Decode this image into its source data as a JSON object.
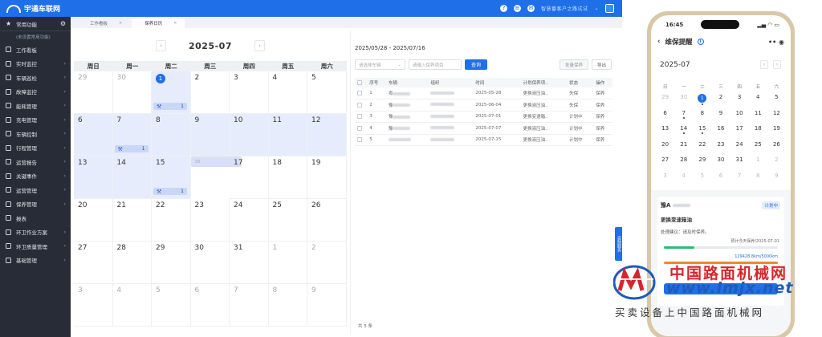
{
  "app": {
    "logo_text": "宇通车联网",
    "user_masked": "智慧番客户之路试试"
  },
  "sidebar": {
    "favorites_label": "常用功能",
    "favorites_empty": "(未设置常用功能)",
    "items": [
      {
        "label": "工作看板",
        "arrow": false
      },
      {
        "label": "实时监控",
        "arrow": true
      },
      {
        "label": "车辆巡检",
        "arrow": true
      },
      {
        "label": "故障监控",
        "arrow": true
      },
      {
        "label": "能耗管理",
        "arrow": true
      },
      {
        "label": "充电管理",
        "arrow": true
      },
      {
        "label": "车辆控制",
        "arrow": true
      },
      {
        "label": "行程管理",
        "arrow": true
      },
      {
        "label": "运营报告",
        "arrow": true
      },
      {
        "label": "关键事件",
        "arrow": true
      },
      {
        "label": "运营管理",
        "arrow": true
      },
      {
        "label": "保养管理",
        "arrow": true
      },
      {
        "label": "报表",
        "arrow": false
      },
      {
        "label": "环卫作业方案",
        "arrow": true
      },
      {
        "label": "环卫质量管理",
        "arrow": true
      },
      {
        "label": "基础管理",
        "arrow": true
      }
    ]
  },
  "tabs": [
    {
      "label": "工作看板"
    },
    {
      "label": "保养日历"
    }
  ],
  "calendar": {
    "month": "2025-07",
    "prev": "‹",
    "next": "›",
    "weekdays": [
      "周日",
      "周一",
      "周二",
      "周三",
      "周四",
      "周五",
      "周六"
    ],
    "days": [
      {
        "d": "29",
        "out": true
      },
      {
        "d": "30",
        "out": true
      },
      {
        "d": "1",
        "today": true,
        "hl": true,
        "badge": "1"
      },
      {
        "d": "2"
      },
      {
        "d": "3"
      },
      {
        "d": "4"
      },
      {
        "d": "5"
      },
      {
        "d": "6",
        "hl": true
      },
      {
        "d": "7",
        "hl": true,
        "badge": "1"
      },
      {
        "d": "8",
        "hl": true
      },
      {
        "d": "9",
        "hl": true
      },
      {
        "d": "10",
        "hl": true
      },
      {
        "d": "11",
        "hl": true
      },
      {
        "d": "12",
        "hl": true
      },
      {
        "d": "13",
        "hl": true
      },
      {
        "d": "14",
        "hl": true
      },
      {
        "d": "15",
        "hl": true,
        "badge": "1"
      },
      {
        "d": "16",
        "sel": true
      },
      {
        "d": "17"
      },
      {
        "d": "18"
      },
      {
        "d": "19"
      },
      {
        "d": "20"
      },
      {
        "d": "21"
      },
      {
        "d": "22"
      },
      {
        "d": "23"
      },
      {
        "d": "24"
      },
      {
        "d": "25"
      },
      {
        "d": "26"
      },
      {
        "d": "27"
      },
      {
        "d": "28"
      },
      {
        "d": "29"
      },
      {
        "d": "30"
      },
      {
        "d": "31"
      },
      {
        "d": "1",
        "out": true
      },
      {
        "d": "2",
        "out": true
      },
      {
        "d": "3",
        "out": true
      },
      {
        "d": "4",
        "out": true
      },
      {
        "d": "5",
        "out": true
      },
      {
        "d": "6",
        "out": true
      },
      {
        "d": "7",
        "out": true
      },
      {
        "d": "8",
        "out": true
      },
      {
        "d": "9",
        "out": true
      }
    ]
  },
  "panel": {
    "range": "2025/05/28 - 2025/07/16",
    "select_placeholder": "请选择车辆",
    "input_placeholder": "请输入保养项目",
    "query": "查询",
    "batch": "批量保养",
    "export": "导出",
    "headers": [
      "序号",
      "车辆",
      "组织",
      "时间",
      "计划保养项..",
      "状态",
      "操作"
    ],
    "rows": [
      {
        "no": "1",
        "plate": "粤",
        "time": "2025-05-28",
        "item": "更换液压油..",
        "status": "失保",
        "status_red": true,
        "op": "保养"
      },
      {
        "no": "2",
        "plate": "豫",
        "time": "2025-06-04",
        "item": "更换液压油..",
        "status": "失保",
        "status_red": true,
        "op": "保养"
      },
      {
        "no": "3",
        "plate": "豫",
        "time": "2025-07-01",
        "item": "更换变速箱..",
        "status": "计划中",
        "status_red": false,
        "op": "保养"
      },
      {
        "no": "4",
        "plate": "豫",
        "time": "2025-07-07",
        "item": "更换液压油..",
        "status": "计划中",
        "status_red": false,
        "op": "保养"
      },
      {
        "no": "5",
        "plate": "",
        "time": "2025-07-15",
        "item": "更换液压油..",
        "status": "计划中",
        "status_red": false,
        "op": "保养"
      }
    ],
    "total": "共 5 条",
    "side_tab": "自助服务"
  },
  "phone": {
    "time": "16:45",
    "title": "维保提醒",
    "month": "2025-07",
    "weekdays": [
      "日",
      "一",
      "二",
      "三",
      "四",
      "五",
      "六"
    ],
    "days": [
      {
        "d": "29",
        "o": true
      },
      {
        "d": "30",
        "o": true
      },
      {
        "d": "1",
        "t": true,
        "dot": true
      },
      {
        "d": "2"
      },
      {
        "d": "3"
      },
      {
        "d": "4"
      },
      {
        "d": "5"
      },
      {
        "d": "6"
      },
      {
        "d": "7",
        "dot": true
      },
      {
        "d": "8"
      },
      {
        "d": "9"
      },
      {
        "d": "10"
      },
      {
        "d": "11"
      },
      {
        "d": "12"
      },
      {
        "d": "13"
      },
      {
        "d": "14",
        "dot": true
      },
      {
        "d": "15",
        "dot": true
      },
      {
        "d": "16"
      },
      {
        "d": "17"
      },
      {
        "d": "18"
      },
      {
        "d": "19"
      },
      {
        "d": "20"
      },
      {
        "d": "21"
      },
      {
        "d": "22"
      },
      {
        "d": "23"
      },
      {
        "d": "24"
      },
      {
        "d": "25"
      },
      {
        "d": "26"
      },
      {
        "d": "27"
      },
      {
        "d": "28"
      },
      {
        "d": "29"
      },
      {
        "d": "30"
      },
      {
        "d": "31"
      },
      {
        "d": "1",
        "o": true
      },
      {
        "d": "2",
        "o": true
      },
      {
        "d": "3",
        "o": true
      },
      {
        "d": "4",
        "o": true
      },
      {
        "d": "5",
        "o": true
      },
      {
        "d": "6",
        "o": true
      },
      {
        "d": "7",
        "o": true
      },
      {
        "d": "8",
        "o": true
      },
      {
        "d": "9",
        "o": true
      }
    ],
    "card": {
      "plate": "豫A",
      "tag": "计划中",
      "title": "更换变速箱油",
      "suggestion": "处理建议：请及时保养。",
      "expected": "预计今天保养/2025-07-01",
      "km": "129428.8km/5000km",
      "progress": 0.27
    }
  },
  "watermark": {
    "line1": "中国路面机械网",
    "line2": "www.lmjx.net",
    "line3": "买卖设备上中国路面机械网"
  },
  "colors": {
    "primary": "#1e6fe8",
    "sidebar": "#272c36",
    "alert": "#e53935",
    "watermark_red": "#d8252a"
  }
}
